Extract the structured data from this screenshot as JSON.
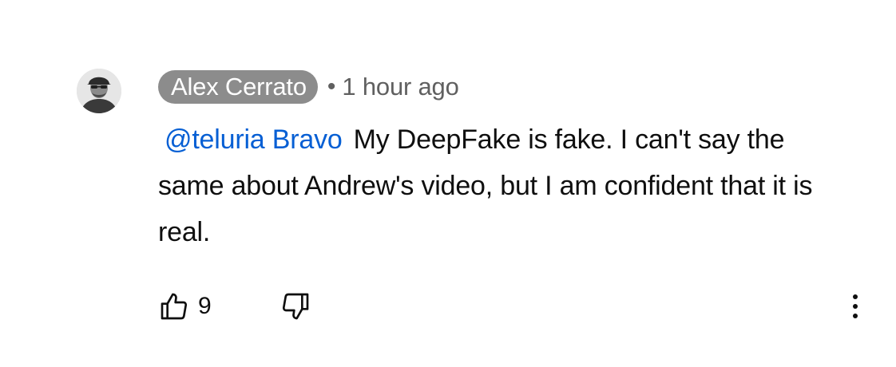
{
  "comment": {
    "author": "Alex Cerrato",
    "separator": "•",
    "time": "1 hour ago",
    "mention": "@teluria Bravo",
    "text": "My DeepFake is fake. I can't say the same about Andrew's video, but I am confident that it is real.",
    "like_count": "9"
  },
  "icons": {
    "avatar": "user-avatar",
    "like": "thumbs-up-icon",
    "dislike": "thumbs-down-icon",
    "more": "more-vert-icon"
  },
  "colors": {
    "author_chip_bg": "#8c8c8c",
    "mention": "#065fd4",
    "meta_text": "#606060"
  }
}
